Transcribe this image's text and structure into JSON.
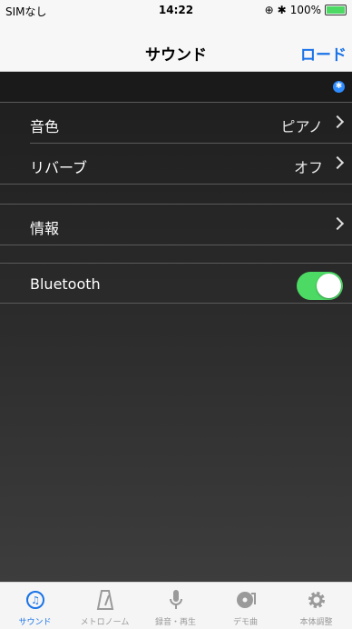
{
  "status_bar": {
    "carrier": "SIMなし",
    "time": "14:22",
    "battery": "100%"
  },
  "nav": {
    "title": "サウンド",
    "right_button": "ロード"
  },
  "rows": [
    {
      "label": "音色",
      "value": "ピアノ"
    },
    {
      "label": "リバーブ",
      "value": "オフ"
    }
  ],
  "info_row": {
    "label": "情報"
  },
  "bluetooth_row": {
    "label": "Bluetooth",
    "enabled": true
  },
  "tabs": [
    {
      "label": "サウンド",
      "icon": "sound-icon",
      "active": true
    },
    {
      "label": "メトロノーム",
      "icon": "metronome-icon",
      "active": false
    },
    {
      "label": "録音・再生",
      "icon": "microphone-icon",
      "active": false
    },
    {
      "label": "デモ曲",
      "icon": "demo-music-icon",
      "active": false
    },
    {
      "label": "本体調整",
      "icon": "gear-icon",
      "active": false
    }
  ],
  "colors": {
    "accent": "#1a73e8",
    "toggle_on": "#4cd964",
    "background": "#2f2f2f"
  }
}
